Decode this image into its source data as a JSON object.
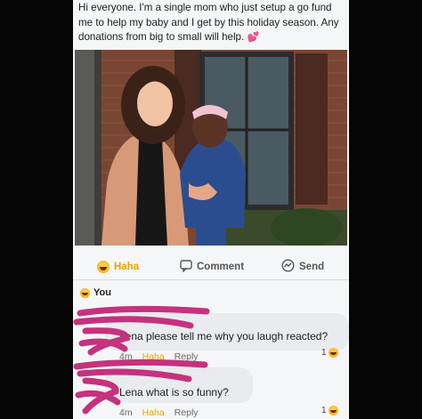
{
  "post": {
    "text": "Hi everyone. I'm a single mom who just setup a go fund me to help my baby and I get by this holiday season. Any donations from big to small will help.",
    "emoji": "💕"
  },
  "actions": {
    "haha_label": "Haha",
    "comment_label": "Comment",
    "send_label": "Send"
  },
  "reaction_summary": {
    "label": "You"
  },
  "comments": [
    {
      "text": "Lena please tell me why you laugh reacted?",
      "time": "4m",
      "reaction_link": "Haha",
      "reply_label": "Reply",
      "reaction_count": "1"
    },
    {
      "text": "Lena what is so funny?",
      "time": "4m",
      "reaction_link": "Haha",
      "reply_label": "Reply",
      "reaction_count": "1"
    }
  ],
  "colors": {
    "haha": "#e7a400",
    "scribble": "#c5327e",
    "background": "#060606",
    "card": "#f5f6f7"
  }
}
